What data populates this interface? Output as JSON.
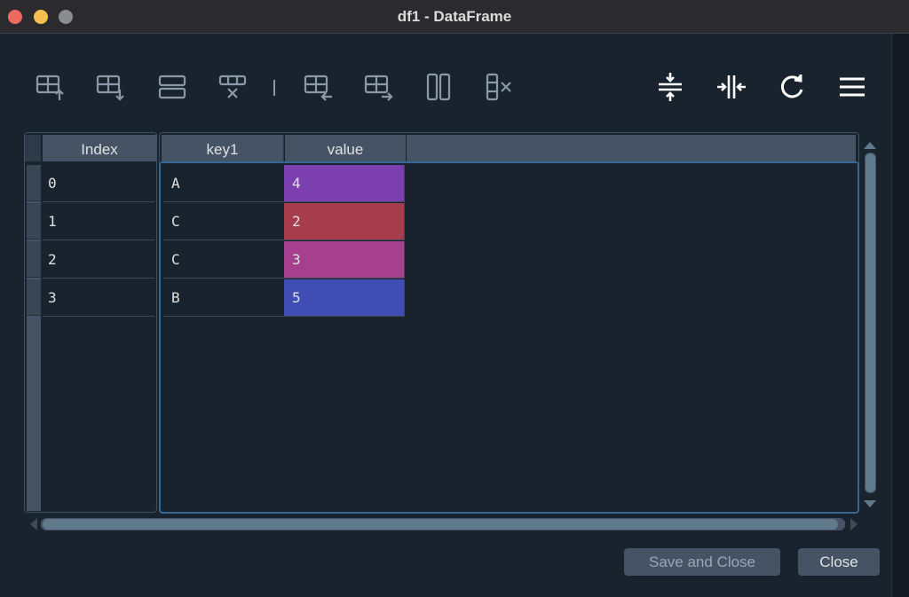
{
  "window": {
    "title": "df1 - DataFrame"
  },
  "toolbar": {
    "left_icons": [
      "insert-row-above-icon",
      "insert-row-below-icon",
      "duplicate-row-icon",
      "remove-row-icon",
      "insert-column-left-icon",
      "insert-column-right-icon",
      "duplicate-column-icon",
      "remove-column-icon"
    ],
    "right_icons": [
      "resize-rows-icon",
      "resize-columns-icon",
      "refresh-icon",
      "menu-icon"
    ]
  },
  "table": {
    "index_header": "Index",
    "columns": [
      "key1",
      "value"
    ],
    "rows": [
      {
        "index": "0",
        "key1": "A",
        "value": "4",
        "color": "#7b3fb0"
      },
      {
        "index": "1",
        "key1": "C",
        "value": "2",
        "color": "#a63c4c"
      },
      {
        "index": "2",
        "key1": "C",
        "value": "3",
        "color": "#a63f8e"
      },
      {
        "index": "3",
        "key1": "B",
        "value": "5",
        "color": "#3f4db5"
      }
    ]
  },
  "buttons": {
    "save_close": "Save and Close",
    "close": "Close"
  },
  "colors": {
    "background": "#19232d",
    "header": "#455364",
    "accent_border": "#346792"
  }
}
